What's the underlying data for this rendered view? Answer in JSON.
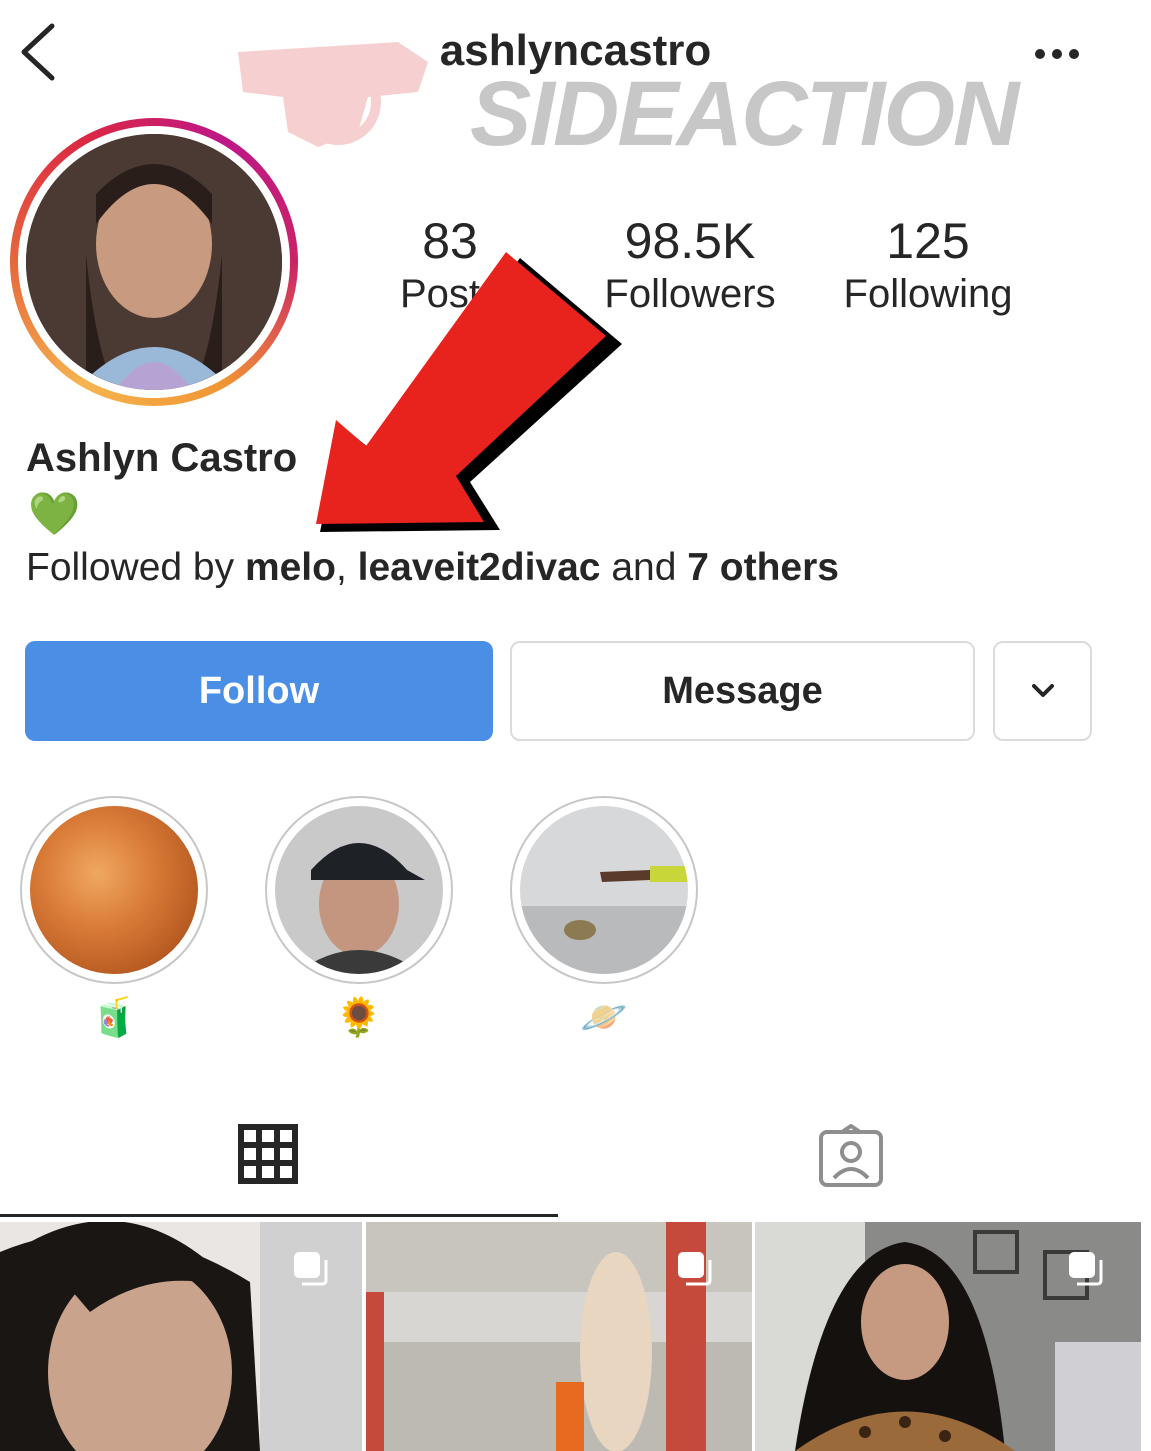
{
  "header": {
    "username": "ashlyncastro",
    "back_icon": "chevron-left-icon",
    "more_icon": "more-horizontal-icon"
  },
  "watermark": {
    "text": "SIDEACTION"
  },
  "stats": [
    {
      "value": "83",
      "label": "Posts"
    },
    {
      "value": "98.5K",
      "label": "Followers"
    },
    {
      "value": "125",
      "label": "Following"
    }
  ],
  "profile": {
    "display_name": "Ashlyn Castro",
    "bio_emoji": "💚",
    "followed_by": {
      "prefix": "Followed by ",
      "user1": "melo",
      "sep": ", ",
      "user2": "leaveit2divac",
      "and": " and ",
      "others": "7 others"
    }
  },
  "actions": {
    "follow_label": "Follow",
    "message_label": "Message",
    "more_icon": "chevron-down-icon"
  },
  "highlights": [
    {
      "label": "🧃"
    },
    {
      "label": "🌻"
    },
    {
      "label": "🪐"
    }
  ],
  "tabs": {
    "grid_icon": "grid-icon",
    "tagged_icon": "tagged-person-icon"
  },
  "colors": {
    "follow_button": "#4a8ee6",
    "text": "#262626",
    "border": "#dbdbdb",
    "annotation_arrow": "#e8231e"
  }
}
